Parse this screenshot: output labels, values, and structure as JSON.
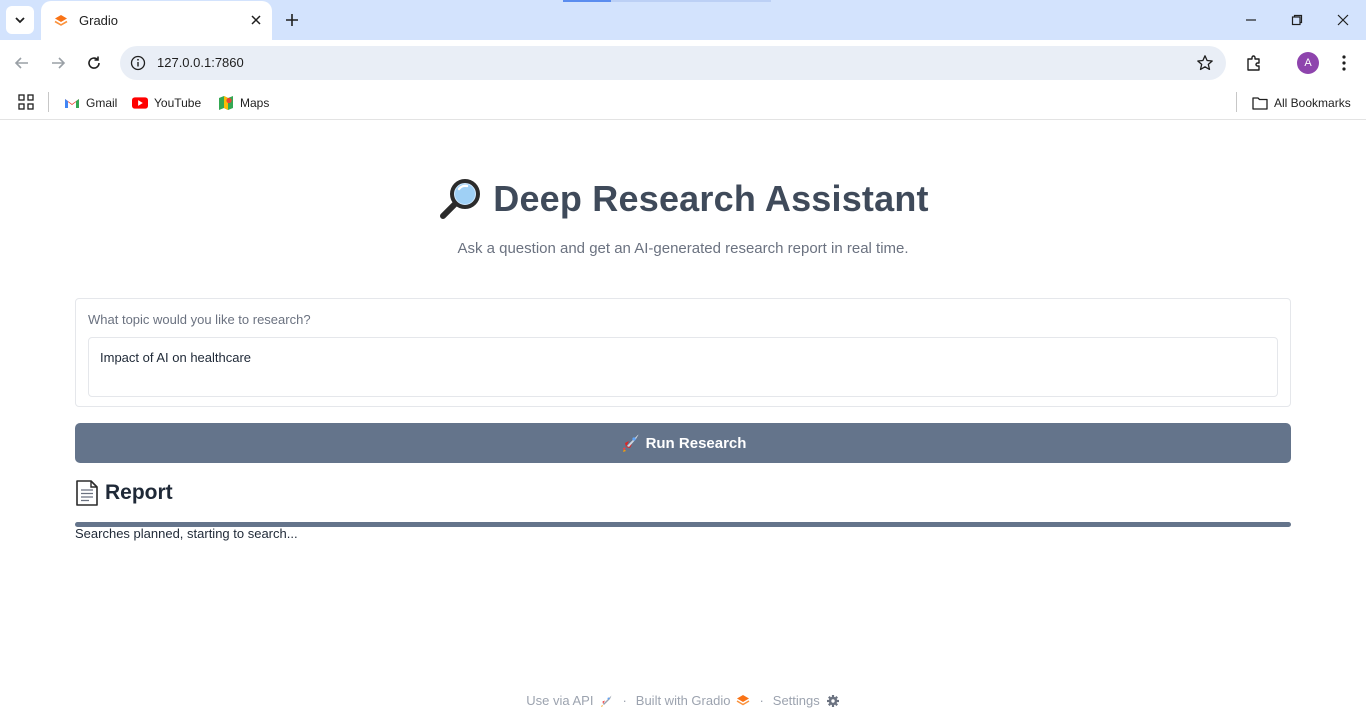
{
  "browser": {
    "tab_title": "Gradio",
    "url": "127.0.0.1:7860",
    "avatar_letter": "A",
    "bookmarks": [
      {
        "label": "Gmail",
        "icon": "gmail-icon"
      },
      {
        "label": "YouTube",
        "icon": "youtube-icon"
      },
      {
        "label": "Maps",
        "icon": "maps-icon"
      }
    ],
    "all_bookmarks_label": "All Bookmarks"
  },
  "page": {
    "title": "Deep Research Assistant",
    "title_icon": "magnifying-glass-icon",
    "subtitle": "Ask a question and get an AI-generated research report in real time.",
    "input": {
      "label": "What topic would you like to research?",
      "value": "Impact of AI on healthcare"
    },
    "run_button": {
      "label": "Run Research",
      "icon": "rocket-icon"
    },
    "report": {
      "heading": "Report",
      "icon": "document-icon",
      "progress": 1.0,
      "status": "Searches planned, starting to search..."
    }
  },
  "footer": {
    "api_label": "Use via API",
    "built_label": "Built with Gradio",
    "settings_label": "Settings",
    "separator": "·"
  },
  "colors": {
    "accent": "#64748b",
    "title": "#3f4a5a",
    "tabbar": "#d3e3fd"
  }
}
